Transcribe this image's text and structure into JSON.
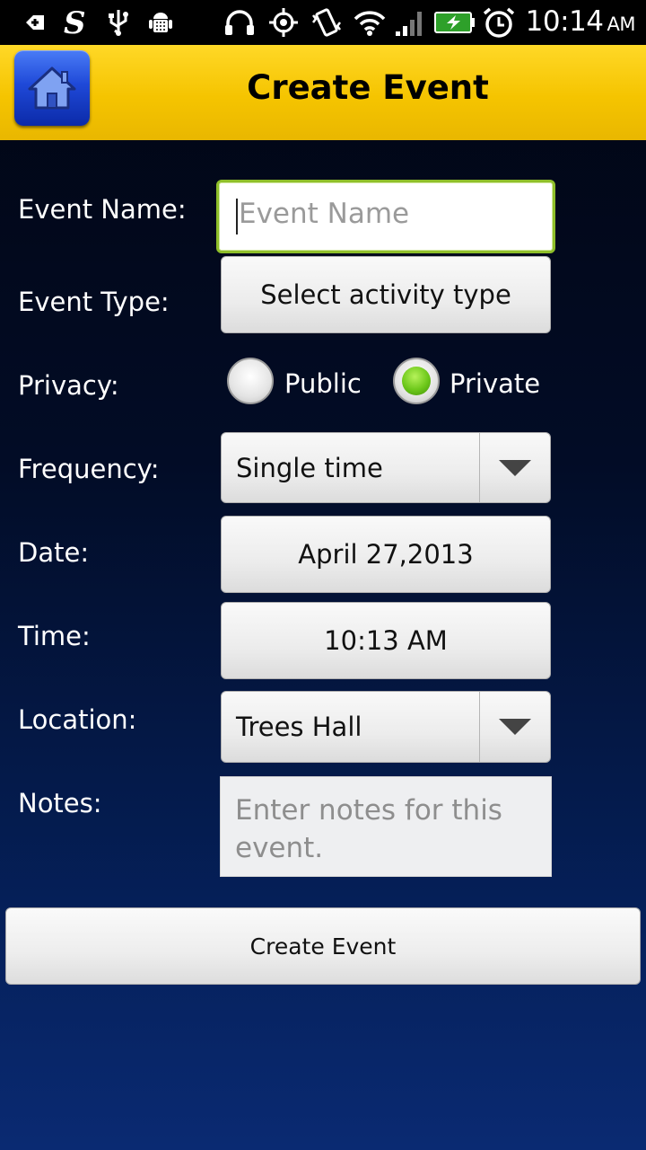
{
  "status_bar": {
    "time": "10:14",
    "ampm": "AM",
    "icons": [
      "add-icon",
      "s-app-icon",
      "usb-icon",
      "android-debug-icon",
      "headphones-icon",
      "gps-icon",
      "vibrate-icon",
      "wifi-icon",
      "signal-icon",
      "battery-charging-icon",
      "alarm-icon"
    ]
  },
  "header": {
    "title": "Create Event",
    "home_icon": "home-icon"
  },
  "form": {
    "event_name": {
      "label": "Event Name:",
      "placeholder": "Event Name",
      "value": ""
    },
    "event_type": {
      "label": "Event Type:",
      "button": "Select activity type"
    },
    "privacy": {
      "label": "Privacy:",
      "options": [
        {
          "label": "Public",
          "checked": false
        },
        {
          "label": "Private",
          "checked": true
        }
      ]
    },
    "frequency": {
      "label": "Frequency:",
      "value": "Single time"
    },
    "date": {
      "label": "Date:",
      "value": "April 27,2013"
    },
    "time": {
      "label": "Time:",
      "value": "10:13 AM"
    },
    "location": {
      "label": "Location:",
      "value": "Trees Hall"
    },
    "notes": {
      "label": "Notes:",
      "placeholder": "Enter notes for this event."
    }
  },
  "create_button": "Create Event",
  "colors": {
    "header_yellow": "#f5c400",
    "home_blue": "#1f49d8",
    "focus_green": "#8fbf2a",
    "radio_checked": "#6cc71a",
    "background_top": "#010512",
    "background_bottom": "#0a2a72"
  }
}
